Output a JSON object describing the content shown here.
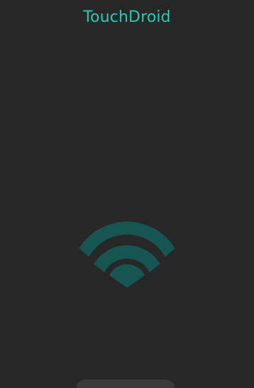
{
  "app": {
    "title": "TouchDroid"
  },
  "status": {
    "icon": "wifi-icon"
  },
  "toast": {
    "text": ""
  },
  "colors": {
    "background": "#272727",
    "accent": "#27c9b8",
    "icon": "#175552"
  }
}
